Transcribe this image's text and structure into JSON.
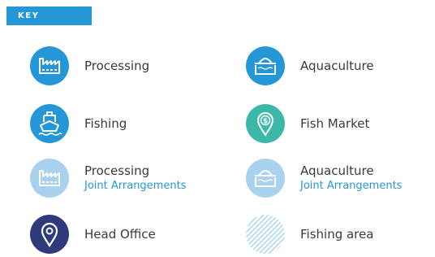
{
  "key": {
    "title": "KEY"
  },
  "legend": {
    "processing": {
      "label": "Processing",
      "icon": "factory-icon",
      "color": "#2596d6"
    },
    "aquaculture": {
      "label": "Aquaculture",
      "icon": "aquaculture-cage-icon",
      "color": "#2596d6"
    },
    "fishing": {
      "label": "Fishing",
      "icon": "fishing-boat-icon",
      "color": "#2596d6"
    },
    "fish_market": {
      "label": "Fish Market",
      "icon": "dollar-pin-icon",
      "color": "#3bb8a8"
    },
    "processing_joint": {
      "label": "Processing",
      "sublabel": "Joint Arrangements",
      "icon": "factory-icon",
      "color": "#a9d2ee"
    },
    "aquaculture_joint": {
      "label": "Aquaculture",
      "sublabel": "Joint Arrangements",
      "icon": "aquaculture-cage-icon",
      "color": "#a9d2ee"
    },
    "head_office": {
      "label": "Head Office",
      "icon": "location-pin-icon",
      "color": "#2e3a7c"
    },
    "fishing_area": {
      "label": "Fishing area",
      "icon": "hatched-circle-icon",
      "color": "#a9d2ee"
    }
  }
}
